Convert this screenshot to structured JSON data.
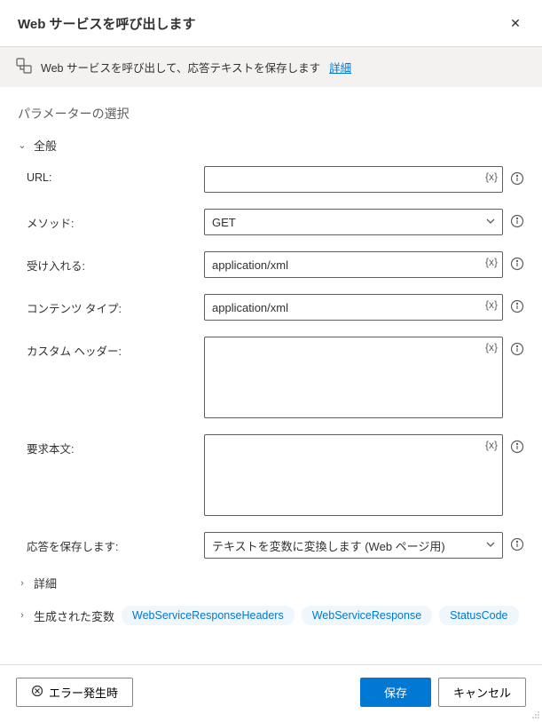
{
  "header": {
    "title": "Web サービスを呼び出します"
  },
  "infoBar": {
    "description": "Web サービスを呼び出して、応答テキストを保存します",
    "detailsLink": "詳細"
  },
  "sections": {
    "parametersTitle": "パラメーターの選択",
    "general": "全般",
    "details": "詳細",
    "generatedVars": "生成された変数"
  },
  "fields": {
    "url": {
      "label": "URL:",
      "value": ""
    },
    "method": {
      "label": "メソッド:",
      "value": "GET"
    },
    "accept": {
      "label": "受け入れる:",
      "value": "application/xml"
    },
    "contentType": {
      "label": "コンテンツ タイプ:",
      "value": "application/xml"
    },
    "customHeaders": {
      "label": "カスタム ヘッダー:",
      "value": ""
    },
    "requestBody": {
      "label": "要求本文:",
      "value": ""
    },
    "saveResponse": {
      "label": "応答を保存します:",
      "value": "テキストを変数に変換します (Web ページ用)"
    }
  },
  "variableToken": "{x}",
  "generatedVariables": [
    "WebServiceResponseHeaders",
    "WebServiceResponse",
    "StatusCode"
  ],
  "footer": {
    "onError": "エラー発生時",
    "save": "保存",
    "cancel": "キャンセル"
  }
}
